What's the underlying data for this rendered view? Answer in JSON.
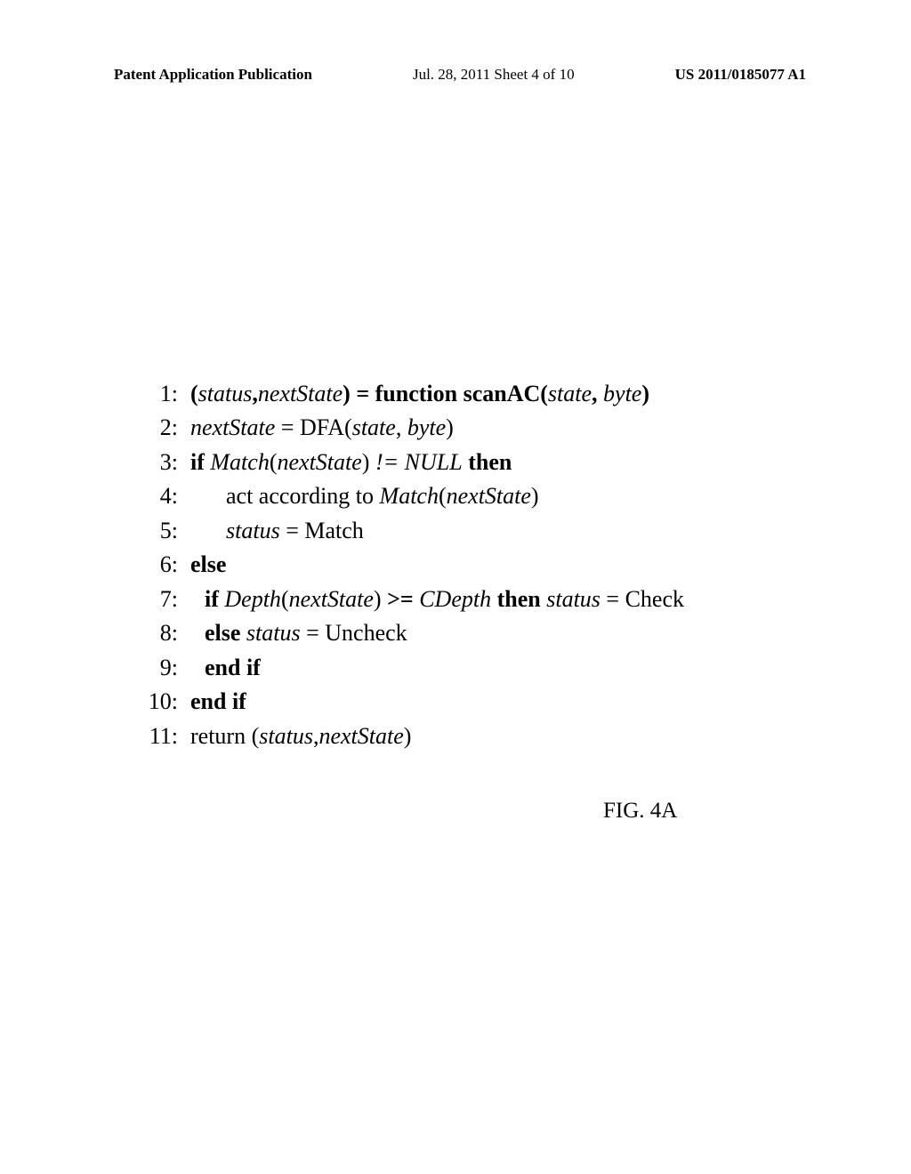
{
  "header": {
    "left": "Patent Application Publication",
    "center": "Jul. 28, 2011  Sheet 4 of 10",
    "right": "US 2011/0185077 A1"
  },
  "algorithm": {
    "lines": {
      "l1_num": "1:",
      "l1_a": "(",
      "l1_b": "status",
      "l1_c": ",",
      "l1_d": "nextState",
      "l1_e": ") = function scanAC(",
      "l1_f": "state",
      "l1_g": ", ",
      "l1_h": "byte",
      "l1_i": ")",
      "l2_num": "2:",
      "l2_a": "nextState",
      "l2_b": " = DFA(",
      "l2_c": "state",
      "l2_d": ", ",
      "l2_e": "byte",
      "l2_f": ")",
      "l3_num": "3:",
      "l3_a": "if ",
      "l3_b": "Match",
      "l3_c": "(",
      "l3_d": "nextState",
      "l3_e": ") ",
      "l3_f": "!= NULL",
      "l3_g": " then",
      "l4_num": "4:",
      "l4_a": "act according to ",
      "l4_b": "Match",
      "l4_c": "(",
      "l4_d": "nextState",
      "l4_e": ")",
      "l5_num": "5:",
      "l5_a": "status",
      "l5_b": " = Match",
      "l6_num": "6:",
      "l6_a": "else",
      "l7_num": "7:",
      "l7_a": "if ",
      "l7_b": "Depth",
      "l7_c": "(",
      "l7_d": "nextState",
      "l7_e": ") ",
      "l7_f": ">= ",
      "l7_g": "CDepth",
      "l7_h": " then",
      "l7_i": "   ",
      "l7_j": "status",
      "l7_k": " = Check",
      "l8_num": "8:",
      "l8_a": "else ",
      "l8_b": "status",
      "l8_c": " = Uncheck",
      "l9_num": "9:",
      "l9_a": "end if",
      "l10_num": "10:",
      "l10_a": "end if",
      "l11_num": "11:",
      "l11_a": "return (",
      "l11_b": "status",
      "l11_c": ",",
      "l11_d": "nextState",
      "l11_e": ")"
    }
  },
  "figure_label": "FIG. 4A"
}
